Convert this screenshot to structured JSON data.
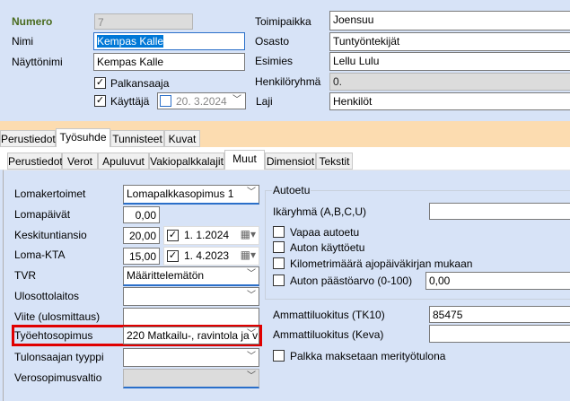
{
  "header": {
    "numero": {
      "label": "Numero",
      "value": "7"
    },
    "nimi": {
      "label": "Nimi",
      "value": "Kempas Kalle"
    },
    "nayttonimi": {
      "label": "Näyttönimi",
      "value": "Kempas Kalle"
    },
    "palkansaaja": {
      "label": "Palkansaaja",
      "checked": true
    },
    "kayttaja": {
      "label": "Käyttäjä",
      "checked": true,
      "date": "20. 3.2024",
      "date_checked": false
    },
    "toimipaikka": {
      "label": "Toimipaikka",
      "value": "Joensuu"
    },
    "osasto": {
      "label": "Osasto",
      "value": "Tuntyöntekijät"
    },
    "esimies": {
      "label": "Esimies",
      "value": "Lellu Lulu"
    },
    "henkiloryhma": {
      "label": "Henkilöryhmä",
      "value": "0."
    },
    "laji": {
      "label": "Laji",
      "value": "Henkilöt"
    }
  },
  "tabs": [
    "Perustiedot",
    "Työsuhde",
    "Tunnisteet",
    "Kuvat"
  ],
  "subtabs": [
    "Perustiedot",
    "Verot",
    "Apuluvut",
    "Vakiopalkkalajit",
    "Muut",
    "Dimensiot",
    "Tekstit"
  ],
  "left": {
    "lomakertoimet": {
      "label": "Lomakertoimet",
      "value": "Lomapalkkasopimus 1"
    },
    "lomapaivat": {
      "label": "Lomapäivät",
      "value": "0,00"
    },
    "keskituntiansio": {
      "label": "Keskituntiansio",
      "value": "20,00",
      "date": "1.  1.2024"
    },
    "lomakta": {
      "label": "Loma-KTA",
      "value": "15,00",
      "date": "1.  4.2023"
    },
    "tvr": {
      "label": "TVR",
      "value": "Määrittelemätön"
    },
    "ulosottolaitos": {
      "label": "Ulosottolaitos",
      "value": ""
    },
    "viite": {
      "label": "Viite (ulosmittaus)",
      "value": ""
    },
    "tyoehtosopimus": {
      "label": "Työehtosopimus",
      "value": "220 Matkailu-, ravintola ja v"
    },
    "tulonsaajan": {
      "label": "Tulonsaajan tyyppi",
      "value": ""
    },
    "verosopimusvaltio": {
      "label": "Verosopimusvaltio",
      "value": ""
    }
  },
  "autoetu": {
    "title": "Autoetu",
    "ikaryhma": {
      "label": "Ikäryhmä (A,B,C,U)",
      "value": ""
    },
    "vapaa": "Vapaa autoetu",
    "kaytto": "Auton käyttöetu",
    "km": "Kilometrimäärä ajopäiväkirjan mukaan",
    "paasto": {
      "label": "Auton päästöarvo (0-100)",
      "value": "0,00"
    }
  },
  "ammatti": {
    "tk10": {
      "label": "Ammattiluokitus (TK10)",
      "value": "85475"
    },
    "keva": {
      "label": "Ammattiluokitus (Keva)",
      "value": ""
    },
    "meri": "Palkka maksetaan merityötulona"
  },
  "colors": {
    "background": "#d7e3f7",
    "tabstrip": "#fcdcb0",
    "highlight": "#e00000",
    "label_green": "#4a6b1e"
  }
}
